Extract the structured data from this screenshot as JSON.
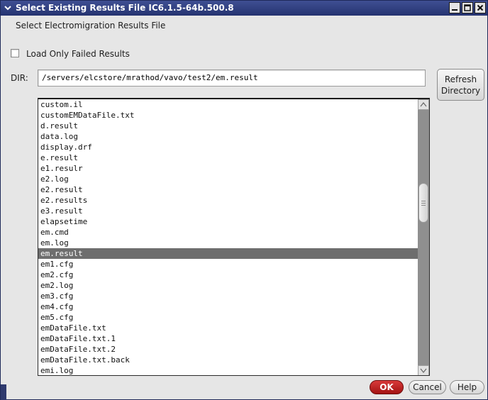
{
  "window": {
    "title": "Select Existing Results File IC6.1.5-64b.500.8",
    "icons": {
      "menu": "chevron-down-icon",
      "minimize": "minimize-icon",
      "maximize": "maximize-icon",
      "close": "close-icon"
    },
    "title_color": "#2c3a7a"
  },
  "header": {
    "subtitle": "Select Electromigration Results File"
  },
  "options": {
    "load_failed_label": "Load Only Failed Results",
    "load_failed_checked": false
  },
  "dir": {
    "label": "DIR:",
    "value": "/servers/elcstore/mrathod/vavo/test2/em.result",
    "refresh_line1": "Refresh",
    "refresh_line2": "Directory"
  },
  "files": [
    "custom.il",
    "customEMDataFile.txt",
    "d.result",
    "data.log",
    "display.drf",
    "e.result",
    "e1.resulr",
    "e2.log",
    "e2.result",
    "e2.results",
    "e3.result",
    "elapsetime",
    "em.cmd",
    "em.log",
    "em.result",
    "em1.cfg",
    "em2.cfg",
    "em2.log",
    "em3.cfg",
    "em4.cfg",
    "em5.cfg",
    "emDataFile.txt",
    "emDataFile.txt.1",
    "emDataFile.txt.2",
    "emDataFile.txt.back",
    "emi.log"
  ],
  "selected_file": "em.result",
  "buttons": {
    "ok": "OK",
    "cancel": "Cancel",
    "help": "Help"
  },
  "colors": {
    "ok_button": "#c41e1e",
    "selection": "#6e6e6e"
  }
}
